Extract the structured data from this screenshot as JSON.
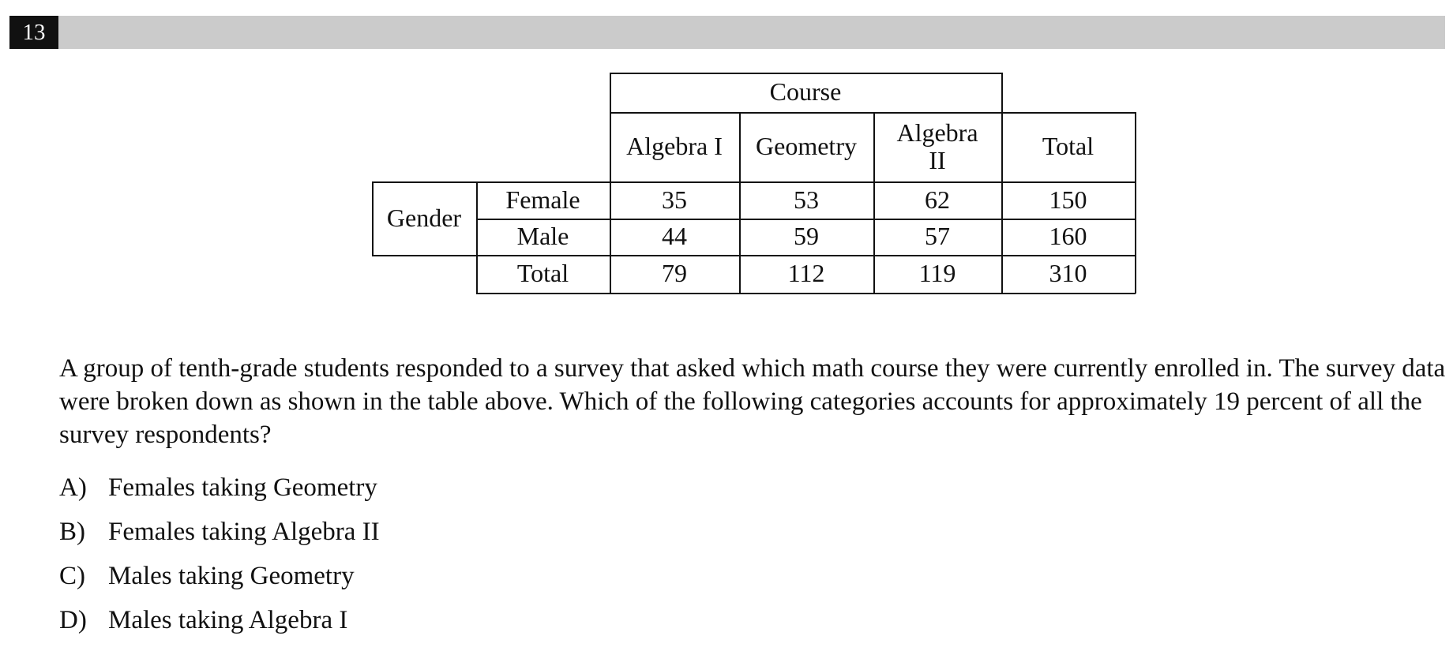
{
  "question_number": "13",
  "table": {
    "course_header": "Course",
    "columns": [
      "Algebra I",
      "Geometry",
      "Algebra II",
      "Total"
    ],
    "group_label": "Gender",
    "rows": [
      {
        "label": "Female",
        "values": [
          "35",
          "53",
          "62",
          "150"
        ]
      },
      {
        "label": "Male",
        "values": [
          "44",
          "59",
          "57",
          "160"
        ]
      },
      {
        "label": "Total",
        "values": [
          "79",
          "112",
          "119",
          "310"
        ]
      }
    ]
  },
  "question_text": "A group of tenth-grade students responded to a survey that asked which math course they were currently enrolled in. The survey data were broken down as shown in the table above.  Which of the following categories accounts for approximately 19 percent of all the survey respondents?",
  "choices": [
    {
      "letter": "A)",
      "text": "Females taking Geometry"
    },
    {
      "letter": "B)",
      "text": "Females taking Algebra II"
    },
    {
      "letter": "C)",
      "text": "Males taking Geometry"
    },
    {
      "letter": "D)",
      "text": "Males taking Algebra I"
    }
  ]
}
